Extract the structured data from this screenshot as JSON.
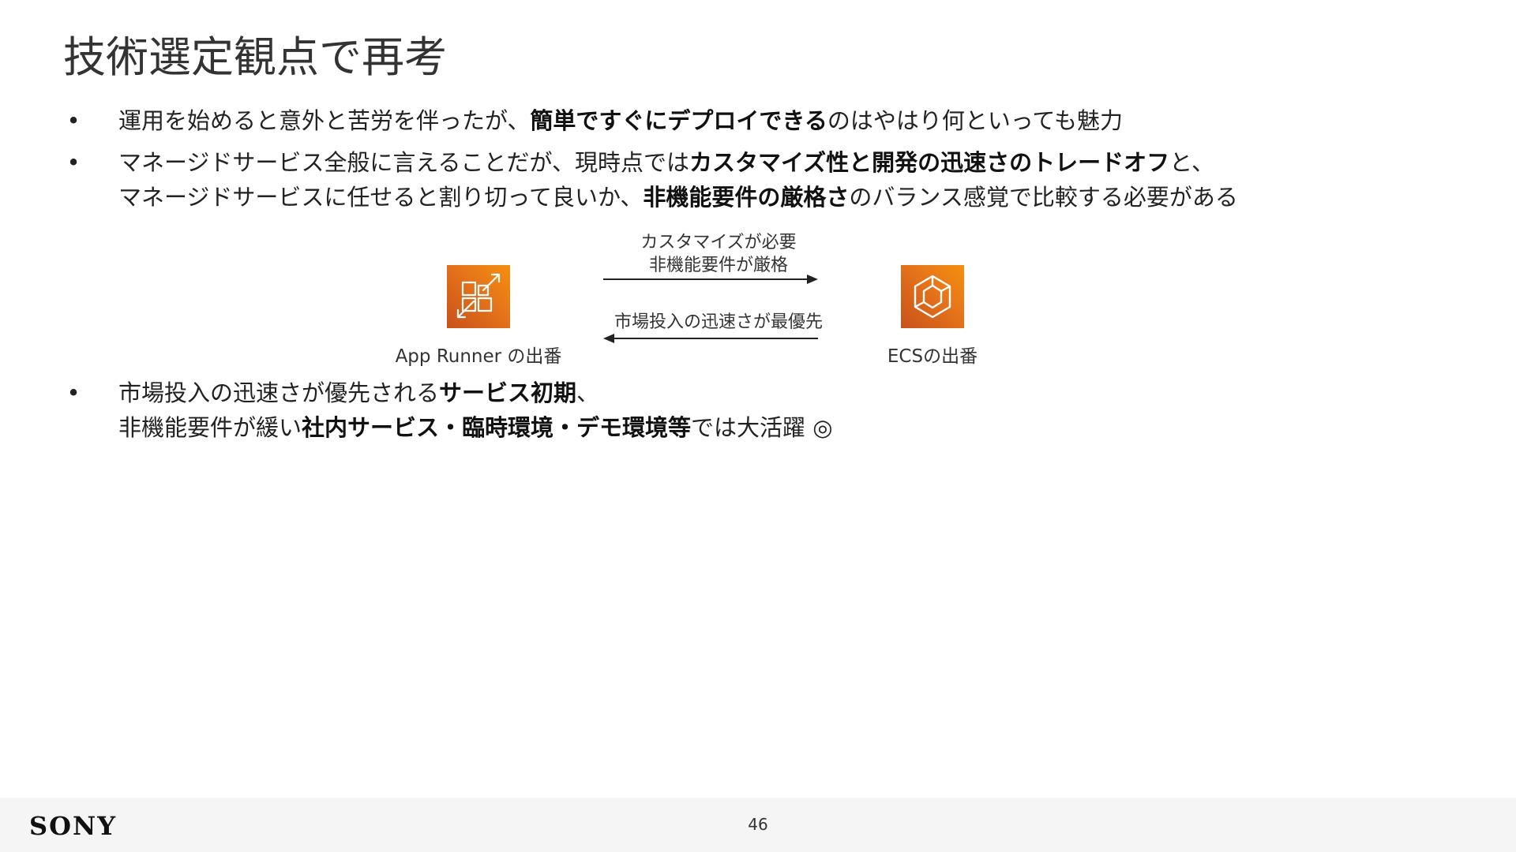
{
  "slide": {
    "title": "技術選定観点で再考"
  },
  "bullets": [
    {
      "marker": "•",
      "lines": [
        [
          {
            "text": "運用を始めると意外と苦労を伴ったが、",
            "bold": false
          },
          {
            "text": "簡単ですぐにデプロイできる",
            "bold": true
          },
          {
            "text": "のはやはり何といっても魅力",
            "bold": false
          }
        ]
      ]
    },
    {
      "marker": "•",
      "lines": [
        [
          {
            "text": "マネージドサービス全般に言えることだが、現時点では",
            "bold": false
          },
          {
            "text": "カスタマイズ性と開発の迅速さのトレードオフ",
            "bold": true
          },
          {
            "text": "と、",
            "bold": false
          }
        ],
        [
          {
            "text": "マネージドサービスに任せると割り切って良いか、",
            "bold": false
          },
          {
            "text": "非機能要件の厳格さ",
            "bold": true
          },
          {
            "text": "のバランス感覚で比較する必要がある",
            "bold": false
          }
        ]
      ]
    },
    {
      "marker": "•",
      "lines": [
        [
          {
            "text": "市場投入の迅速さが優先される",
            "bold": false
          },
          {
            "text": "サービス初期",
            "bold": true
          },
          {
            "text": "、",
            "bold": false
          }
        ],
        [
          {
            "text": "非機能要件が緩い",
            "bold": false
          },
          {
            "text": "社内サービス・臨時環境・デモ環境等",
            "bold": true
          },
          {
            "text": "では大活躍 ◎",
            "bold": false
          }
        ]
      ]
    }
  ],
  "diagram": {
    "left_icon": "app-runner-icon",
    "left_label": "App Runner の出番",
    "right_icon": "ecs-icon",
    "right_label": "ECSの出番",
    "arrow_right_lines": [
      "カスタマイズが必要",
      "非機能要件が厳格"
    ],
    "arrow_left_label": "市場投入の迅速さが最優先",
    "icon_color": "#e7761a"
  },
  "footer": {
    "logo": "SONY",
    "page_number": "46"
  }
}
